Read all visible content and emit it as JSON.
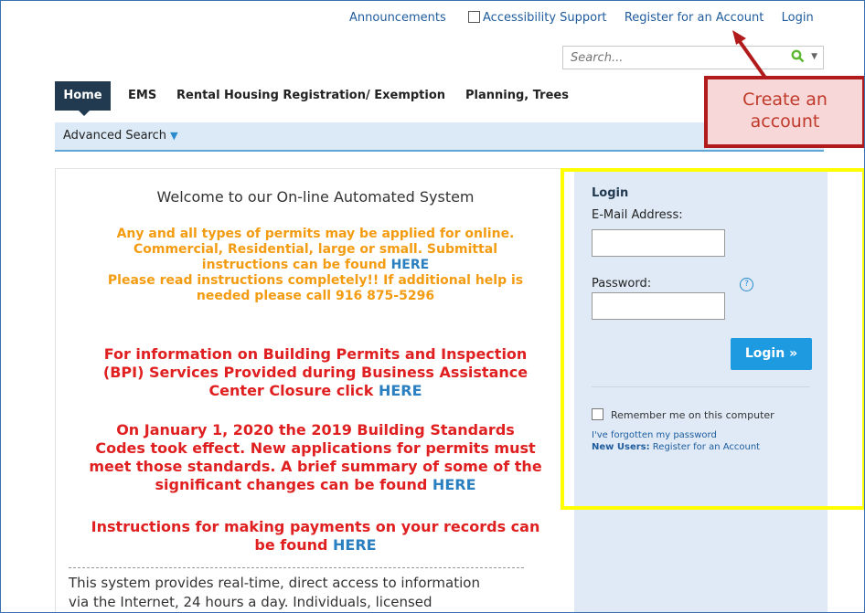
{
  "top_links": {
    "announcements": "Announcements",
    "accessibility": "Accessibility Support",
    "register": "Register for an Account",
    "login": "Login"
  },
  "search": {
    "placeholder": "Search..."
  },
  "nav": {
    "tabs": [
      "Home",
      "EMS",
      "Rental Housing Registration/ Exemption",
      "Planning, Trees"
    ]
  },
  "subnav": {
    "advanced_search": "Advanced Search"
  },
  "main": {
    "welcome": "Welcome to our On-line Automated System",
    "orange": {
      "line1": "Any and all types of permits may be applied for online.",
      "line2": "Commercial, Residential, large or small. Submittal",
      "line3_pre": "instructions can be found ",
      "here": "HERE",
      "line4": "Please read instructions completely!! If additional help is",
      "line5": "needed please call 916 875-5296"
    },
    "bpi": {
      "line1": "For information on Building Permits and Inspection",
      "line2": "(BPI) Services Provided during Business Assistance",
      "line3_pre": "Center Closure click ",
      "here": "HERE"
    },
    "codes": {
      "line1": "On January 1, 2020 the 2019 Building  Standards",
      "line2": "Codes took effect. New applications for permits must",
      "line3": "meet those standards. A brief summary of some of the",
      "line4_pre": "significant changes can be found ",
      "here": "HERE"
    },
    "payments": {
      "line1": "Instructions for making payments on your records can",
      "line2_pre": "be found ",
      "here": "HERE"
    },
    "desc": {
      "line1": "This system provides real-time, direct access to information",
      "line2": "via the Internet, 24 hours a day. Individuals, licensed"
    }
  },
  "login": {
    "title": "Login",
    "email_label": "E-Mail Address:",
    "password_label": "Password:",
    "help": "?",
    "button": "Login »",
    "remember": "Remember me on this computer",
    "forgot": "I've forgotten my password",
    "new_users_label": "New Users:",
    "new_users_link": "Register for an Account"
  },
  "annotation": {
    "callout_line1": "Create an",
    "callout_line2": "account"
  }
}
